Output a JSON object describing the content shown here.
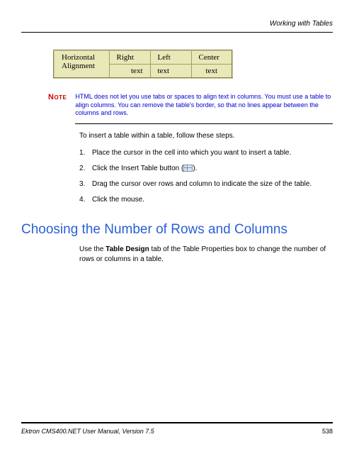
{
  "header": {
    "title": "Working with Tables"
  },
  "example": {
    "label1": "Horizontal",
    "label2": "Alignment",
    "col1_head": "Right",
    "col2_head": "Left",
    "col3_head": "Center",
    "sample": "text"
  },
  "note": {
    "label": "Note",
    "text": "HTML does not let you use tabs or spaces to align text in columns. You must use a table to align columns. You can remove the table's border, so that no lines appear between the columns and rows."
  },
  "intro": "To insert a table within a table, follow these steps.",
  "steps": {
    "s1": "Place the cursor in the cell into which you want to insert a table.",
    "s2a": "Click the Insert Table button (",
    "s2b": ").",
    "s3": "Drag the cursor over rows and column to indicate the size of the table.",
    "s4": "Click the mouse."
  },
  "section": {
    "heading": "Choosing the Number of Rows and Columns",
    "body_a": "Use the ",
    "body_bold": "Table Design",
    "body_b": " tab of the Table Properties box to change the number of rows or columns in a table."
  },
  "footer": {
    "left": "Ektron CMS400.NET User Manual, Version 7.5",
    "right": "538"
  }
}
